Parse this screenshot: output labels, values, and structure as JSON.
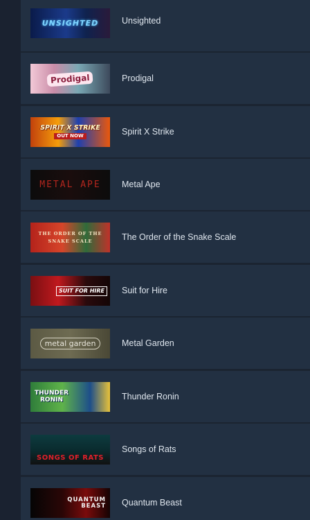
{
  "games": [
    {
      "title": "Unsighted",
      "art_text": "UNSIGHTED",
      "art_subtext": "",
      "art_theme": "blue-neon"
    },
    {
      "title": "Prodigal",
      "art_text": "Prodigal",
      "art_subtext": "",
      "art_theme": "pastel-character"
    },
    {
      "title": "Spirit X Strike",
      "art_text": "SPIRIT X STRIKE",
      "art_subtext": "OUT NOW",
      "art_theme": "fire-orange"
    },
    {
      "title": "Metal Ape",
      "art_text": "METAL APE",
      "art_subtext": "",
      "art_theme": "dark-red"
    },
    {
      "title": "The Order of the Snake Scale",
      "art_text": "THE ORDER OF THE",
      "art_subtext": "SNAKE SCALE",
      "art_theme": "red-green-snake"
    },
    {
      "title": "Suit for Hire",
      "art_text": "SUIT FOR HIRE",
      "art_subtext": "",
      "art_theme": "crimson-dark"
    },
    {
      "title": "Metal Garden",
      "art_text": "metal garden",
      "art_subtext": "",
      "art_theme": "olive-grey"
    },
    {
      "title": "Thunder Ronin",
      "art_text": "THUNDER",
      "art_subtext": "RONIN",
      "art_theme": "green-ninja"
    },
    {
      "title": "Songs of Rats",
      "art_text": "SONGS OF RATS",
      "art_subtext": "",
      "art_theme": "teal-red"
    },
    {
      "title": "Quantum Beast",
      "art_text": "QUANTUM",
      "art_subtext": "BEAST",
      "art_theme": "black-red"
    }
  ]
}
